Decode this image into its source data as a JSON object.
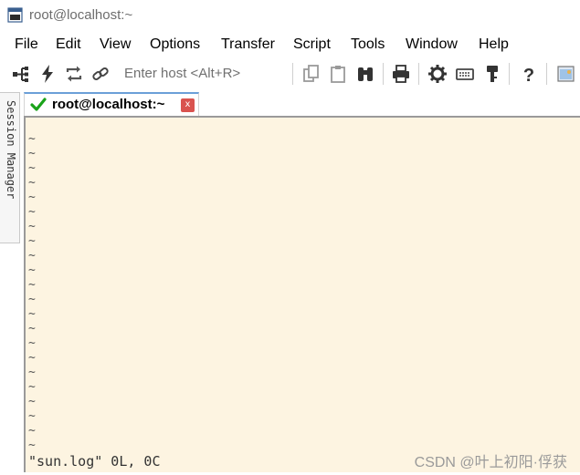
{
  "window": {
    "title": "root@localhost:~"
  },
  "menu": [
    "File",
    "Edit",
    "View",
    "Options",
    "Transfer",
    "Script",
    "Tools",
    "Window",
    "Help"
  ],
  "toolbar": {
    "host_placeholder": "Enter host <Alt+R>",
    "icons": [
      "connect-tree-icon",
      "lightning-icon",
      "reconnect-icon",
      "link-icon",
      "copy-icon",
      "paste-icon",
      "binoculars-icon",
      "print-icon",
      "gear-icon",
      "keyboard-icon",
      "key-icon",
      "help-icon",
      "session-image-icon"
    ]
  },
  "side_panel": {
    "label": "Session Manager"
  },
  "tab": {
    "label": "root@localhost:~",
    "close": "x"
  },
  "terminal": {
    "tildes": [
      "~",
      "~",
      "~",
      "~",
      "~",
      "~",
      "~",
      "~",
      "~",
      "~",
      "~",
      "~",
      "~",
      "~",
      "~",
      "~",
      "~",
      "~",
      "~",
      "~",
      "~",
      "~"
    ],
    "status": "\"sun.log\" 0L, 0C"
  },
  "watermark": "CSDN @叶上初阳·俘获",
  "colors": {
    "terminal_bg": "#fdf4e1",
    "tab_close": "#d9534f",
    "tab_check": "#1aa31a"
  }
}
